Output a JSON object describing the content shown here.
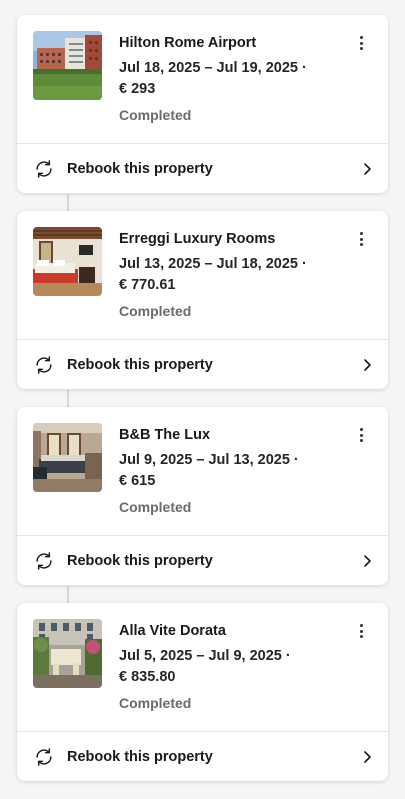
{
  "bookings": [
    {
      "name": "Hilton Rome Airport",
      "dates": "Jul 18, 2025 – Jul 19, 2025 ·",
      "price": "€ 293",
      "status": "Completed",
      "rebook_label": "Rebook this property"
    },
    {
      "name": "Erreggi Luxury Rooms",
      "dates": "Jul 13, 2025 – Jul 18, 2025 ·",
      "price": "€ 770.61",
      "status": "Completed",
      "rebook_label": "Rebook this property"
    },
    {
      "name": "B&B The Lux",
      "dates": "Jul 9, 2025 – Jul 13, 2025 ·",
      "price": "€ 615",
      "status": "Completed",
      "rebook_label": "Rebook this property"
    },
    {
      "name": "Alla Vite Dorata",
      "dates": "Jul 5, 2025 – Jul 9, 2025 ·",
      "price": "€ 835.80",
      "status": "Completed",
      "rebook_label": "Rebook this property"
    }
  ],
  "icons": {
    "more": "more-vertical-icon",
    "rebook": "rebook-refresh-icon",
    "chevron": "chevron-right-icon"
  },
  "colors": {
    "background": "#f5f5f5",
    "card": "#ffffff",
    "status_text": "#6b6b6b"
  }
}
